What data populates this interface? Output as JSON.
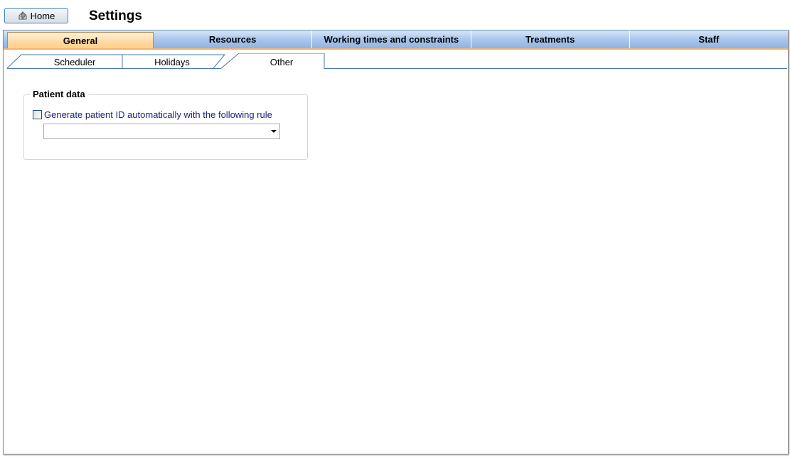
{
  "header": {
    "home_label": "Home",
    "title": "Settings"
  },
  "main_tabs": [
    {
      "label": "General",
      "active": true
    },
    {
      "label": "Resources",
      "active": false
    },
    {
      "label": "Working times and constraints",
      "active": false
    },
    {
      "label": "Treatments",
      "active": false
    },
    {
      "label": "Staff",
      "active": false
    }
  ],
  "sub_tabs": [
    {
      "label": "Scheduler",
      "active": false
    },
    {
      "label": "Holidays",
      "active": false
    },
    {
      "label": "Other",
      "active": true
    }
  ],
  "patient_data": {
    "legend": "Patient data",
    "auto_id_label": "Generate patient ID automatically with the following rule",
    "auto_id_checked": false,
    "rule_value": ""
  },
  "colors": {
    "active_tab": "#ffd9a0",
    "tab_bar": "#a9c6ec",
    "checkbox_label": "#1a237e"
  }
}
